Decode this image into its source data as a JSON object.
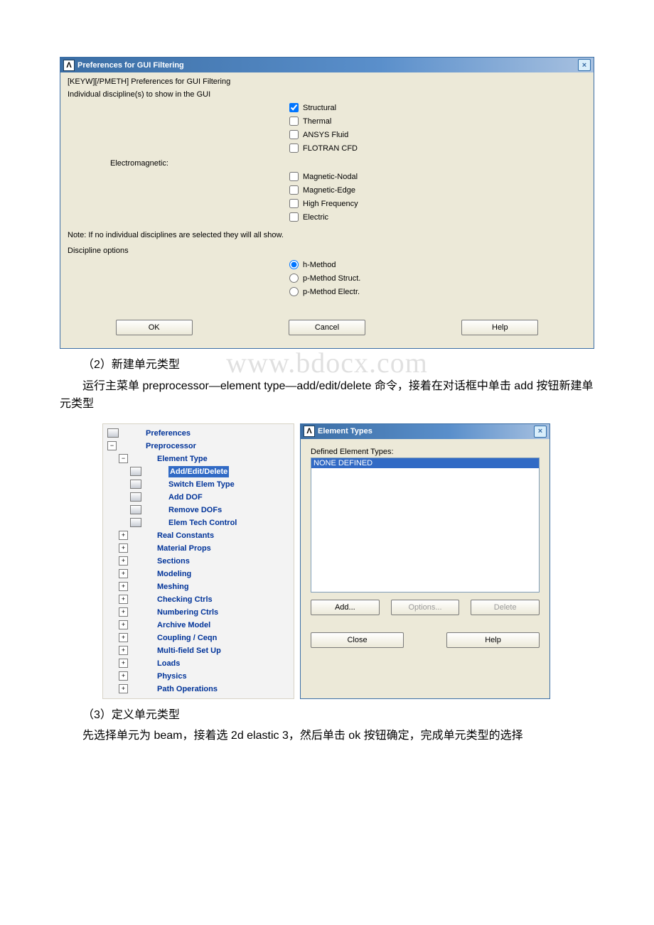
{
  "pref_dialog": {
    "title": "Preferences for GUI Filtering",
    "line1": "[KEYW][/PMETH] Preferences for GUI Filtering",
    "line2": "Individual discipline(s) to show in the GUI",
    "checks": {
      "structural": "Structural",
      "thermal": "Thermal",
      "ansys_fluid": "ANSYS Fluid",
      "flotran": "FLOTRAN CFD"
    },
    "electromagnetic_label": "Electromagnetic:",
    "em": {
      "mag_nodal": "Magnetic-Nodal",
      "mag_edge": "Magnetic-Edge",
      "high_freq": "High Frequency",
      "electric": "Electric"
    },
    "note": "Note: If no individual disciplines are selected they will all show.",
    "disc_opt_label": "Discipline options",
    "methods": {
      "h": "h-Method",
      "p_struct": "p-Method Struct.",
      "p_electr": "p-Method Electr."
    },
    "buttons": {
      "ok": "OK",
      "cancel": "Cancel",
      "help": "Help"
    }
  },
  "text": {
    "heading2": "（2）新建单元类型",
    "para2": "运行主菜单 preprocessor—element type—add/edit/delete 命令，接着在对话框中单击 add 按钮新建单元类型",
    "heading3": "（3）定义单元类型",
    "para3": "先选择单元为 beam，接着选 2d elastic 3，然后单击 ok 按钮确定，完成单元类型的选择",
    "watermark": "www.bdocx.com"
  },
  "main_menu": {
    "preferences": "Preferences",
    "preprocessor": "Preprocessor",
    "element_type": "Element Type",
    "add_edit_delete": "Add/Edit/Delete",
    "switch_elem_type": "Switch Elem Type",
    "add_dof": "Add DOF",
    "remove_dofs": "Remove DOFs",
    "elem_tech_control": "Elem Tech Control",
    "real_constants": "Real Constants",
    "material_props": "Material Props",
    "sections": "Sections",
    "modeling": "Modeling",
    "meshing": "Meshing",
    "checking_ctrls": "Checking Ctrls",
    "numbering_ctrls": "Numbering Ctrls",
    "archive_model": "Archive Model",
    "coupling_ceqn": "Coupling / Ceqn",
    "multifield_setup": "Multi-field Set Up",
    "loads": "Loads",
    "physics": "Physics",
    "path_operations": "Path Operations"
  },
  "et_dialog": {
    "title": "Element Types",
    "defined_label": "Defined Element Types:",
    "none_defined": "NONE DEFINED",
    "buttons": {
      "add": "Add...",
      "options": "Options...",
      "delete": "Delete",
      "close": "Close",
      "help": "Help"
    }
  }
}
